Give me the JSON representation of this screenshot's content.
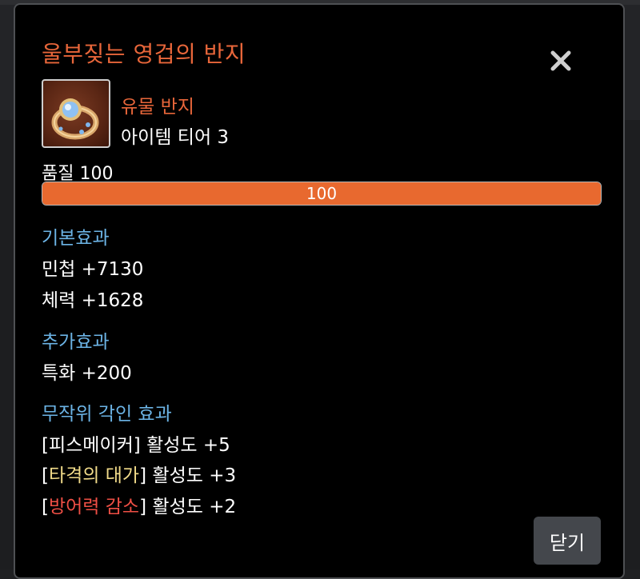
{
  "item": {
    "name": "울부짖는 영겁의 반지",
    "grade": "유물 반지",
    "tier": "아이템 티어 3",
    "quality_label": "품질 100",
    "quality_value": "100",
    "quality_percent": 100
  },
  "sections": {
    "basic": {
      "title": "기본효과",
      "lines": [
        "민첩 +7130",
        "체력 +1628"
      ]
    },
    "additional": {
      "title": "추가효과",
      "lines": [
        "특화 +200"
      ]
    },
    "engraving": {
      "title": "무작위 각인 효과",
      "items": [
        {
          "open": "[",
          "name": "피스메이커",
          "close": "]",
          "effect": " 활성도 +5"
        },
        {
          "open": "[",
          "name": "타격의 대가",
          "close": "]",
          "effect": " 활성도 +3"
        },
        {
          "open": "[",
          "name": "방어력 감소",
          "close": "]",
          "effect": " 활성도 +2"
        }
      ]
    }
  },
  "buttons": {
    "close_label": "닫기"
  },
  "colors": {
    "title": "#e8663a",
    "section_head": "#6cb4e6",
    "quality_fill": "#e8692f",
    "engraving_white": "#ffffff",
    "engraving_yellow": "#f2dc8a",
    "engraving_red": "#ef4f45"
  },
  "icons": {
    "close": "close-icon",
    "item": "ring-icon"
  }
}
